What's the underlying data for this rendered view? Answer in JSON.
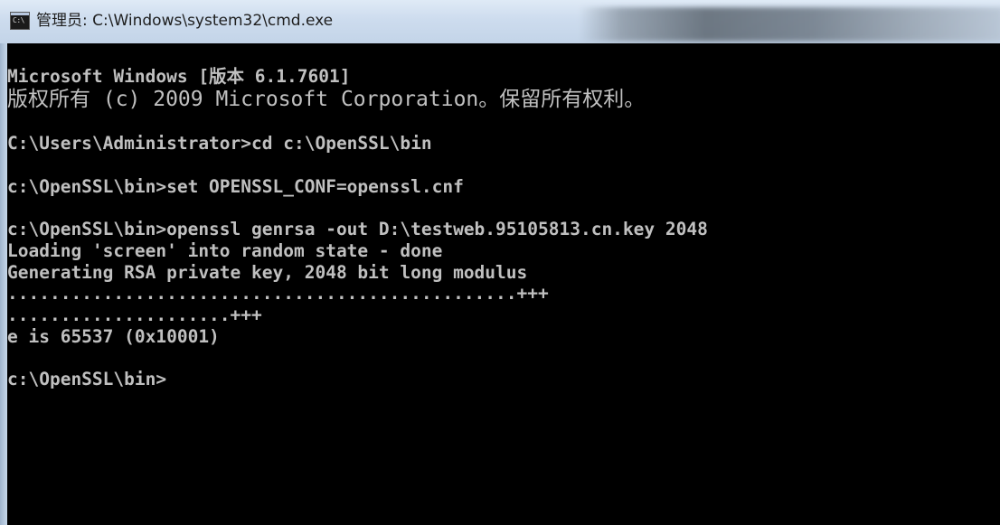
{
  "window": {
    "title": "管理员: C:\\Windows\\system32\\cmd.exe",
    "icon": "cmd-console-icon",
    "icon_text": "C:\\"
  },
  "console": {
    "lines": [
      "Microsoft Windows [版本 6.1.7601]",
      "版权所有 (c) 2009 Microsoft Corporation。保留所有权利。",
      "",
      "C:\\Users\\Administrator>cd c:\\OpenSSL\\bin",
      "",
      "c:\\OpenSSL\\bin>set OPENSSL_CONF=openssl.cnf",
      "",
      "c:\\OpenSSL\\bin>openssl genrsa -out D:\\testweb.95105813.cn.key 2048",
      "Loading 'screen' into random state - done",
      "Generating RSA private key, 2048 bit long modulus",
      "................................................+++",
      ".....................+++",
      "e is 65537 (0x10001)",
      "",
      "c:\\OpenSSL\\bin>"
    ]
  },
  "colors": {
    "console_background": "#000000",
    "console_text": "#c0c0c0",
    "titlebar": "#cddcee"
  }
}
